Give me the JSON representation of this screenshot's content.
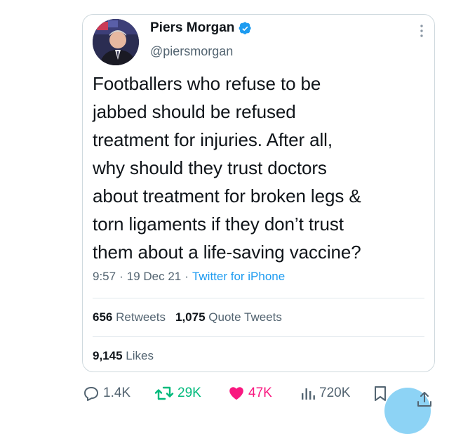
{
  "tweet": {
    "author_name": "Piers Morgan",
    "handle": "@piersmorgan",
    "text": "Footballers who refuse to be\njabbed should be refused\ntreatment for injuries. After all,\nwhy should they trust doctors\nabout treatment for broken legs &\ntorn ligaments if they don’t trust\nthem about a life-saving vaccine?",
    "time": "9:57",
    "date": "19 Dec 21",
    "source": "Twitter for iPhone",
    "separator": "·"
  },
  "stats": {
    "retweets_count": "656",
    "retweets_label": "Retweets",
    "quotes_count": "1,075",
    "quotes_label": "Quote Tweets",
    "likes_count": "9,145",
    "likes_label": "Likes"
  },
  "actions": {
    "reply_count": "1.4K",
    "retweet_count": "29K",
    "like_count": "47K",
    "views_count": "720K"
  },
  "colors": {
    "verified": "#1d9bf0",
    "retweet": "#00ba7c",
    "like": "#f91880",
    "muted": "#536471",
    "link": "#1d9bf0"
  }
}
